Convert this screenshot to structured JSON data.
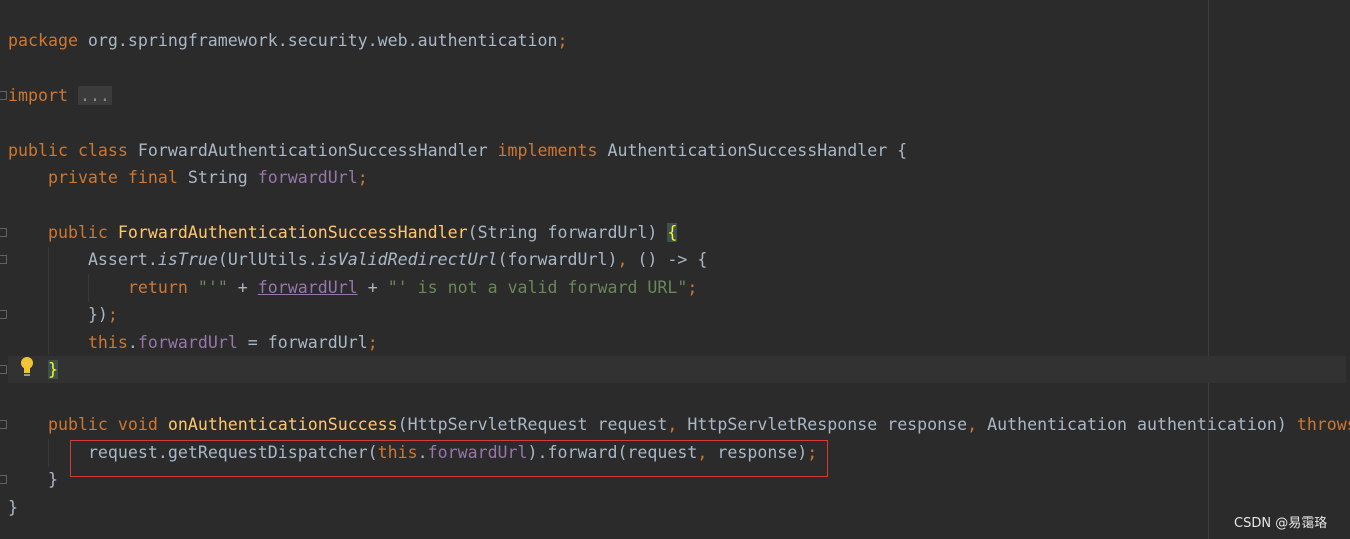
{
  "code": {
    "line_package_kw": "package",
    "line_package_name": " org.springframework.security.web.authentication",
    "line_package_semi": ";",
    "line_import_kw": "import",
    "line_import_fold": "...",
    "class_public": "public",
    "class_class": " class",
    "class_name": " ForwardAuthenticationSuccessHandler",
    "class_implements": " implements",
    "class_iface": " AuthenticationSuccessHandler {",
    "field_private": "private",
    "field_final": " final",
    "field_type": " String",
    "field_name": " forwardUrl",
    "field_semi": ";",
    "ctor_public": "public",
    "ctor_name": " ForwardAuthenticationSuccessHandler",
    "ctor_params": "(String forwardUrl) ",
    "ctor_brace": "{",
    "assert_class": "Assert.",
    "assert_method": "isTrue",
    "assert_open": "(UrlUtils.",
    "assert_valid": "isValidRedirectUrl",
    "assert_args": "(forwardUrl)",
    "assert_comma": ",",
    "assert_lambda": " () -> {",
    "return_kw": "return",
    "return_str1": " \"'\"",
    "return_plus1": " + ",
    "return_field": "forwardUrl",
    "return_plus2": " + ",
    "return_str2": "\"' is not a valid forward URL\"",
    "return_semi": ";",
    "close_lambda": "})",
    "close_lambda_semi": ";",
    "this_kw": "this",
    "this_dot": ".",
    "this_field": "forwardUrl",
    "this_assign": " = forwardUrl",
    "this_semi": ";",
    "ctor_close": "}",
    "method_public": "public",
    "method_void": " void",
    "method_name": " onAuthenticationSuccess",
    "method_params1": "(HttpServletRequest request",
    "method_c1": ",",
    "method_params2": " HttpServletResponse response",
    "method_c2": ",",
    "method_params3": " Authentication authentication) ",
    "method_throws": "throws",
    "body_req": "request.getRequestDispatcher(",
    "body_this": "this",
    "body_dot": ".",
    "body_field": "forwardUrl",
    "body_forward": ").forward(request",
    "body_comma": ",",
    "body_response": " response)",
    "body_semi": ";",
    "method_close": "}",
    "class_close": "}"
  },
  "watermark": "CSDN @易霭珞",
  "colors": {
    "background": "#2b2b2b",
    "keyword": "#cc7832",
    "field": "#9876aa",
    "function": "#ffc66d",
    "string": "#6a8759",
    "text": "#a9b7c6",
    "annotation_box": "#d43b3b"
  }
}
